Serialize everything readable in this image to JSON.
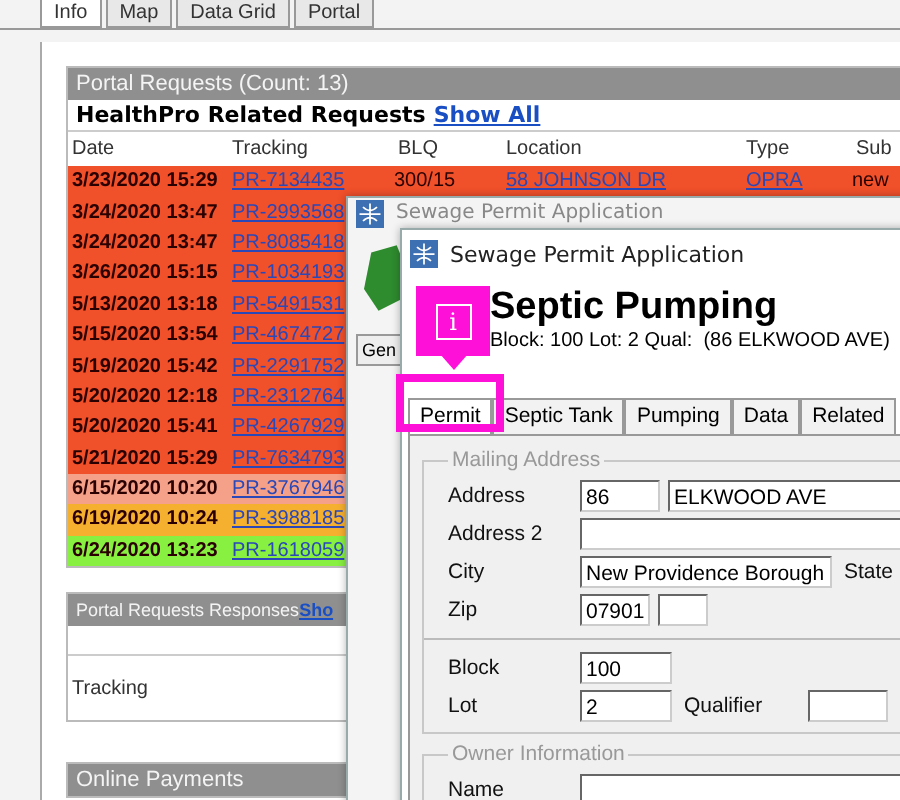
{
  "tabs": [
    {
      "label": "Info",
      "selected": true
    },
    {
      "label": "Map",
      "selected": false
    },
    {
      "label": "Data Grid",
      "selected": false
    },
    {
      "label": "Portal",
      "selected": false
    }
  ],
  "portal_requests": {
    "title": "Portal Requests (Count: 13)",
    "subtitle": "HealthPro Related Requests",
    "link": "Show All",
    "columns": [
      "Date",
      "Tracking",
      "BLQ",
      "Location",
      "Type",
      "Sub"
    ],
    "rows": [
      {
        "date": "3/23/2020 15:29",
        "tracking": "PR-7134435",
        "blq": "300/15",
        "location": "58 JOHNSON DR",
        "type": "OPRA",
        "sub": "new",
        "color": "#f0502a"
      },
      {
        "date": "3/24/2020 13:47",
        "tracking": "PR-2993568",
        "color": "#f0502a"
      },
      {
        "date": "3/24/2020 13:47",
        "tracking": "PR-8085418",
        "color": "#f0502a"
      },
      {
        "date": "3/26/2020 15:15",
        "tracking": "PR-1034193",
        "color": "#f0502a"
      },
      {
        "date": "5/13/2020 13:18",
        "tracking": "PR-5491531",
        "color": "#f0502a"
      },
      {
        "date": "5/15/2020 13:54",
        "tracking": "PR-4674727",
        "color": "#f0502a"
      },
      {
        "date": "5/19/2020 15:42",
        "tracking": "PR-2291752",
        "color": "#f0502a"
      },
      {
        "date": "5/20/2020 12:18",
        "tracking": "PR-2312764",
        "color": "#f0502a"
      },
      {
        "date": "5/20/2020 15:41",
        "tracking": "PR-4267929",
        "color": "#f0502a"
      },
      {
        "date": "5/21/2020 15:29",
        "tracking": "PR-7634793",
        "color": "#f0502a"
      },
      {
        "date": "6/15/2020 10:20",
        "tracking": "PR-3767946",
        "color": "#f5a088"
      },
      {
        "date": "6/19/2020 10:24",
        "tracking": "PR-3988185",
        "color": "#f6b030"
      },
      {
        "date": "6/24/2020 13:23",
        "tracking": "PR-1618059",
        "color": "#88f040"
      }
    ]
  },
  "responses": {
    "title": "Portal Requests Responses",
    "link": "Sho",
    "label": "Tracking"
  },
  "payments": {
    "title": "Online Payments"
  },
  "back_window": {
    "title": "Sewage Permit Application",
    "tab": "Gen"
  },
  "front_window": {
    "title": "Sewage Permit Application",
    "heading": "Septic Pumping",
    "subheading": "Block: 100 Lot: 2 Qual:  (86 ELKWOOD AVE)",
    "callout": "i",
    "tabs": [
      {
        "label": "Permit",
        "selected": true
      },
      {
        "label": "Septic Tank",
        "selected": false
      },
      {
        "label": "Pumping",
        "selected": false
      },
      {
        "label": "Data",
        "selected": false
      },
      {
        "label": "Related",
        "selected": false
      }
    ],
    "mailing_address": {
      "legend": "Mailing Address",
      "address_label": "Address",
      "address_number": "86",
      "address_street": "ELKWOOD AVE",
      "address2_label": "Address 2",
      "city_label": "City",
      "city": "New Providence Borough",
      "state_label": "State",
      "zip_label": "Zip",
      "zip": "07901",
      "block_label": "Block",
      "block": "100",
      "lot_label": "Lot",
      "lot": "2",
      "qualifier_label": "Qualifier"
    },
    "owner_information": {
      "legend": "Owner Information",
      "name_label": "Name"
    }
  }
}
